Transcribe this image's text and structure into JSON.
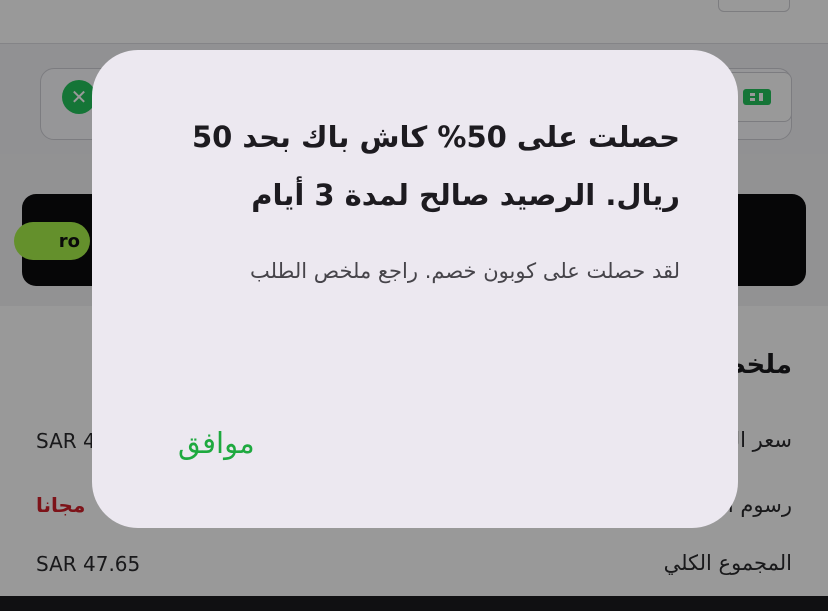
{
  "background": {
    "promo_badge": "ro",
    "summary": {
      "title": "ملخص",
      "rows": [
        {
          "label": "سعر المنتجات",
          "value": "SAR 4",
          "value_color": "#2b2b2d"
        },
        {
          "label": "رسوم التوصيل",
          "value": "مجانا",
          "value_color": "#d0212a"
        },
        {
          "label": "المجموع الكلي",
          "value": "SAR 47.65",
          "value_color": "#2b2b2d"
        }
      ]
    },
    "icons": {
      "remove": "close-icon",
      "coupon": "ticket-icon"
    }
  },
  "dialog": {
    "title": "حصلت على 50% كاش باك بحد 50 ريال. الرصيد صالح لمدة 3 أيام",
    "message": "لقد حصلت على كوبون خصم. راجع ملخص الطلب",
    "ok_label": "موافق",
    "accent_color": "#1ea93f"
  }
}
